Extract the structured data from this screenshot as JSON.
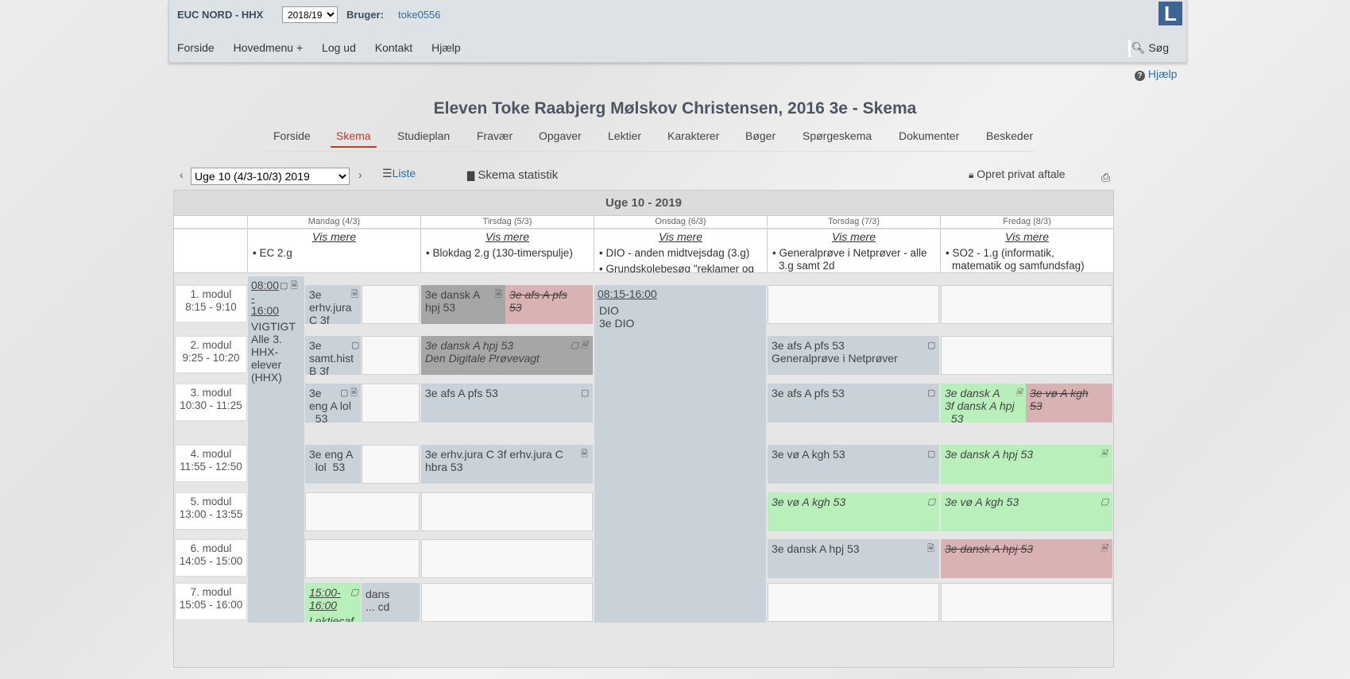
{
  "header": {
    "school": "EUC NORD - HHX",
    "year_selected": "2018/19",
    "bruger_label": "Bruger:",
    "bruger_value": "toke0556",
    "logo": "L",
    "nav": [
      "Forside",
      "Hovedmenu +",
      "Log ud",
      "Kontakt",
      "Hjælp"
    ],
    "search_label": "Søg"
  },
  "help_link": "Hjælp",
  "page_title": "Eleven Toke Raabjerg Mølskov Christensen, 2016 3e - Skema",
  "subnav": {
    "active": "Skema",
    "items": [
      "Forside",
      "Skema",
      "Studieplan",
      "Fravær",
      "Opgaver",
      "Lektier",
      "Karakterer",
      "Bøger",
      "Spørgeskema",
      "Dokumenter",
      "Beskeder"
    ]
  },
  "toolbar": {
    "week_selected": "Uge 10 (4/3-10/3) 2019",
    "liste": "Liste",
    "statistik": "Skema statistik",
    "privat": "Opret privat aftale"
  },
  "schedule": {
    "week_title": "Uge 10 - 2019",
    "vis_mere": "Vis mere",
    "days": [
      {
        "label": "Mandag (4/3)",
        "notes": [
          "• EC 2.g"
        ]
      },
      {
        "label": "Tirsdag (5/3)",
        "notes": [
          "• Blokdag 2.g (130-timerspulje)"
        ]
      },
      {
        "label": "Onsdag (6/3)",
        "notes": [
          "• DIO - anden midtvejsdag (3.g)",
          "• Grundskolebesøg \"reklamer og"
        ]
      },
      {
        "label": "Torsdag (7/3)",
        "notes": [
          "• Generalprøve i Netprøver - alle",
          "3.g samt 2d"
        ]
      },
      {
        "label": "Fredag (8/3)",
        "notes": [
          "• SO2 - 1.g (informatik,",
          "matematik og samfundsfag)"
        ]
      }
    ],
    "modules": [
      {
        "name": "1. modul",
        "time": "8:15 - 9:10"
      },
      {
        "name": "2. modul",
        "time": "9:25 - 10:20"
      },
      {
        "name": "3. modul",
        "time": "10:30 - 11:25"
      },
      {
        "name": "4. modul",
        "time": "11:55 - 12:50"
      },
      {
        "name": "5. modul",
        "time": "13:00 - 13:55"
      },
      {
        "name": "6. modul",
        "time": "14:05 - 15:00"
      },
      {
        "name": "7. modul",
        "time": "15:05 - 16:00"
      }
    ],
    "events": {
      "mon_vigtigt": {
        "time1": "08:00",
        "time2": "-",
        "time3": "16:00",
        "l1": "VIGTIGT",
        "l2": "Alle 3.",
        "l3": "HHX-",
        "l4": "elever",
        "l5": "(HHX)"
      },
      "mon_m1": {
        "l1": "3e",
        "l2": "erhv.jura",
        "l3": "C 3f"
      },
      "mon_m2": {
        "l1": "3e",
        "l2": "samt.hist",
        "l3": "B 3f"
      },
      "mon_m3": {
        "l1": "3e",
        "l2": "eng A  lol",
        "l3": "  53"
      },
      "mon_m4": {
        "l1": "3e eng A",
        "l2": "  lol  53"
      },
      "mon_m7a": {
        "l1": "15:00-",
        "l2": "16:00",
        "l3": "Lektiecaf"
      },
      "mon_m7b": {
        "l1": "dans",
        "l2": "... cd"
      },
      "tue_m1a": {
        "l1": "3e dansk A",
        "l2": "hpj  53"
      },
      "tue_m1b": {
        "l1": "3e afs A  pfs",
        "l2": "53"
      },
      "tue_m2": {
        "l1": "3e dansk A  hpj  53",
        "l2": "Den Digitale Prøvevagt"
      },
      "tue_m3": {
        "l1": "3e afs A  pfs  53"
      },
      "tue_m4": {
        "l1": "3e erhv.jura C 3f erhv.jura C",
        "l2": "hbra  53"
      },
      "wed_dio": {
        "l1": "08:15-16:00",
        "l2": "DIO",
        "l3": "3e DIO"
      },
      "thu_m2": {
        "l1": "3e afs A  pfs  53",
        "l2": "Generalprøve i Netprøver"
      },
      "thu_m3": {
        "l1": "3e afs A  pfs  53"
      },
      "thu_m4": {
        "l1": "3e vø A  kgh  53"
      },
      "thu_m5": {
        "l1": "3e vø A  kgh  53"
      },
      "thu_m6": {
        "l1": "3e dansk A  hpj  53"
      },
      "fri_m3a": {
        "l1": "3e dansk A",
        "l2": "3f dansk A  hpj",
        "l3": "  53"
      },
      "fri_m3b": {
        "l1": "3e vø A  kgh",
        "l2": "53"
      },
      "fri_m4": {
        "l1": "3e dansk A  hpj  53"
      },
      "fri_m5": {
        "l1": "3e vø A  kgh  53"
      },
      "fri_m6": {
        "l1": "3e dansk A  hpj  53"
      }
    }
  },
  "colors": {
    "accent_red": "#c0392b",
    "link_blue": "#2f6ea3",
    "event_blue": "#c8d2d8",
    "event_grey": "#a4a6a7",
    "event_red": "#d9b2b4",
    "event_green": "#b9efbb"
  }
}
